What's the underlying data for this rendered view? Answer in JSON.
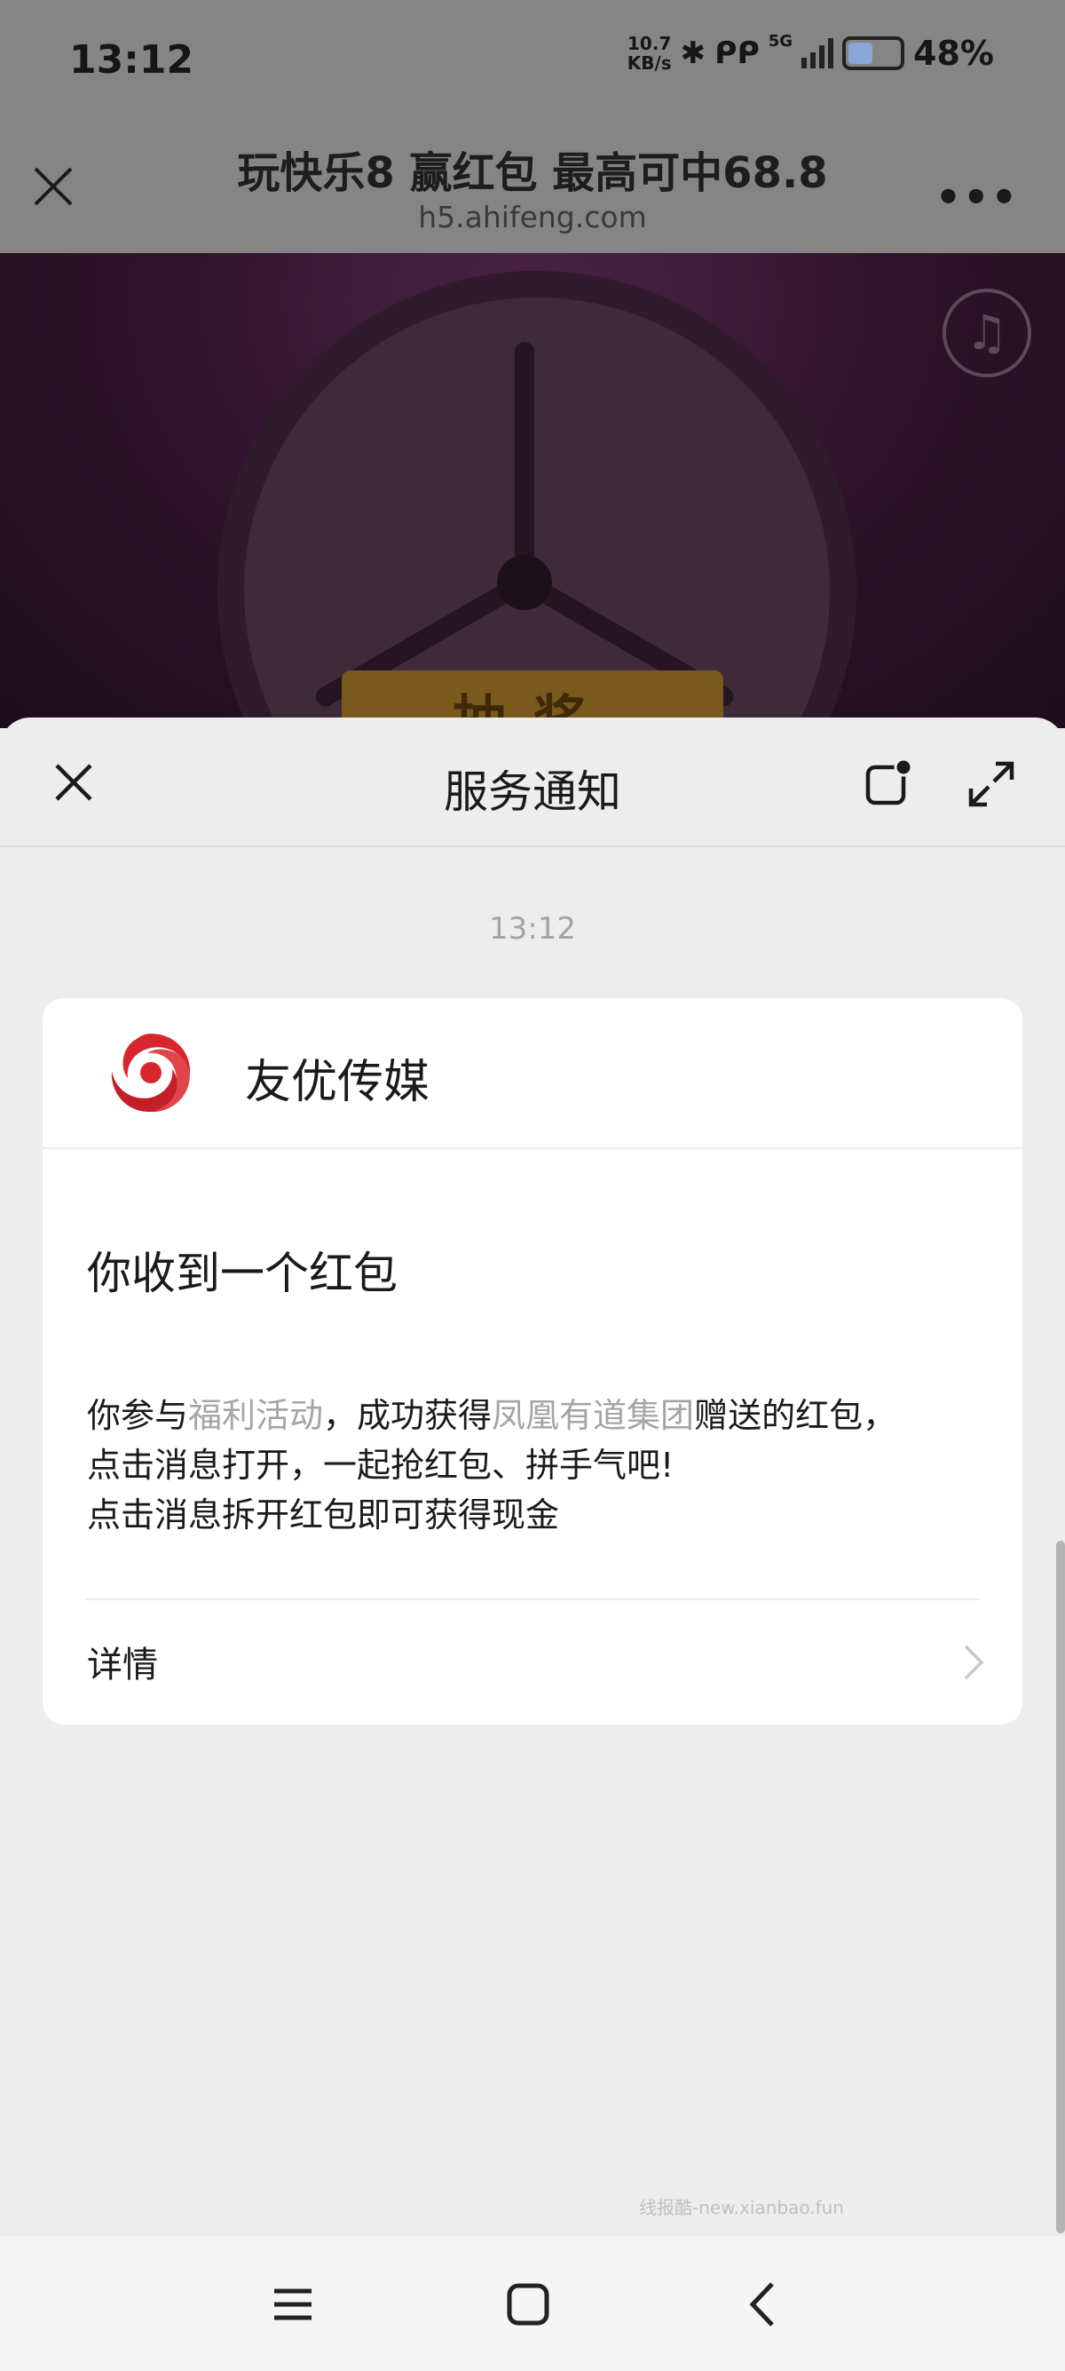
{
  "status_bar": {
    "time": "13:12",
    "speed_value": "10.7",
    "speed_unit": "KB/s",
    "network": "5G",
    "battery_percent": "48%",
    "battery_level": 0.48
  },
  "webview": {
    "title": "玩快乐8 赢红包 最高可中68.8",
    "url": "h5.ahifeng.com",
    "sign_text": "抽奖",
    "music_icon": "music-note-icon"
  },
  "sheet": {
    "title": "服务通知",
    "message_time": "13:12",
    "card": {
      "sender": "友优传媒",
      "title": "你收到一个红包",
      "body_line1_prefix": "你参与",
      "body_line1_hl1": "福利活动",
      "body_line1_mid": "，成功获得",
      "body_line1_hl2": "凤凰有道集团",
      "body_line1_suffix": "赠送的红包，",
      "body_line2": "点击消息打开，一起抢红包、拼手气吧!",
      "body_line3": "点击消息拆开红包即可获得现金",
      "detail_label": "详情"
    },
    "watermark": "线报酷-new.xianbao.fun"
  },
  "colors": {
    "accent_logo": "#d8262e",
    "highlight_text": "#a5a5a5",
    "sheet_bg": "#ededed"
  }
}
